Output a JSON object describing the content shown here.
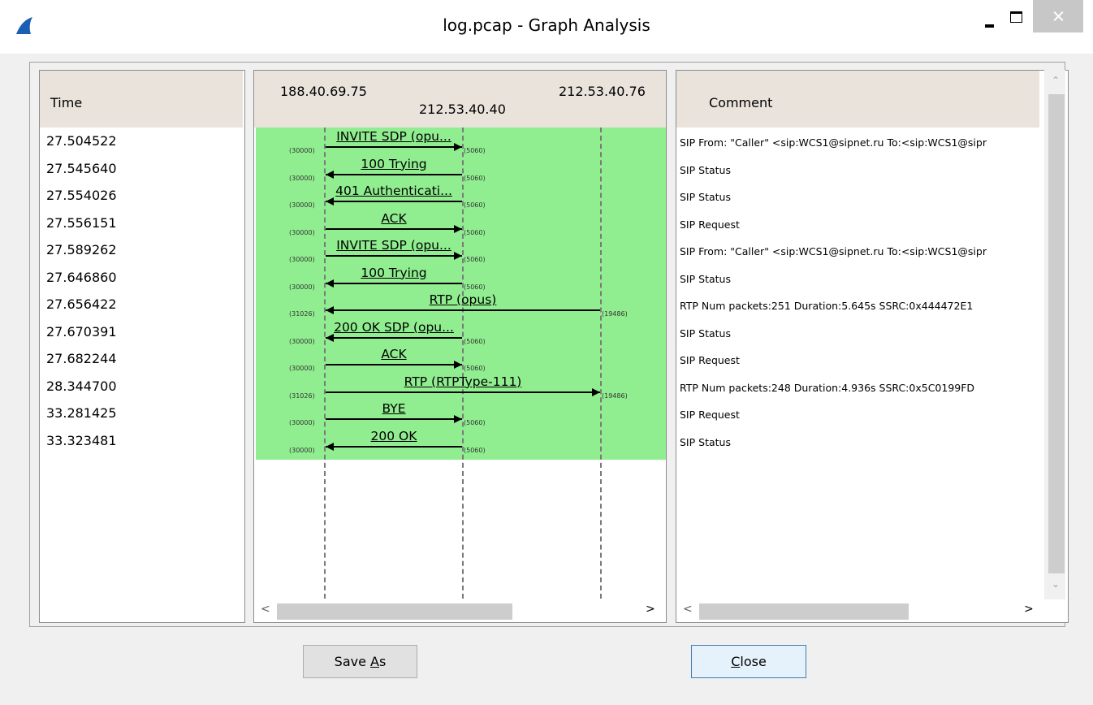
{
  "window": {
    "title": "log.pcap - Graph Analysis"
  },
  "time_pane": {
    "header": "Time",
    "times": [
      "27.504522",
      "27.545640",
      "27.554026",
      "27.556151",
      "27.589262",
      "27.646860",
      "27.656422",
      "27.670391",
      "27.682244",
      "28.344700",
      "33.281425",
      "33.323481"
    ]
  },
  "flow_pane": {
    "nodes": [
      "188.40.69.75",
      "212.53.40.40",
      "212.53.40.76"
    ],
    "messages": [
      {
        "label": "INVITE SDP (opu...",
        "from_port": "(30000)",
        "to_port": "(5060)",
        "direction": "right"
      },
      {
        "label": "100 Trying",
        "from_port": "(30000)",
        "to_port": "(5060)",
        "direction": "left"
      },
      {
        "label": "401 Authenticati...",
        "from_port": "(30000)",
        "to_port": "(5060)",
        "direction": "left"
      },
      {
        "label": "ACK",
        "from_port": "(30000)",
        "to_port": "(5060)",
        "direction": "right"
      },
      {
        "label": "INVITE SDP (opu...",
        "from_port": "(30000)",
        "to_port": "(5060)",
        "direction": "right"
      },
      {
        "label": "100 Trying",
        "from_port": "(30000)",
        "to_port": "(5060)",
        "direction": "left"
      },
      {
        "label": "RTP (opus)",
        "from_port": "(31026)",
        "to_port": "(19486)",
        "direction": "left",
        "span": "wide"
      },
      {
        "label": "200 OK SDP (opu...",
        "from_port": "(30000)",
        "to_port": "(5060)",
        "direction": "left"
      },
      {
        "label": "ACK",
        "from_port": "(30000)",
        "to_port": "(5060)",
        "direction": "right"
      },
      {
        "label": "RTP (RTPType-111)",
        "from_port": "(31026)",
        "to_port": "(19486)",
        "direction": "right",
        "span": "wide"
      },
      {
        "label": "BYE",
        "from_port": "(30000)",
        "to_port": "(5060)",
        "direction": "right"
      },
      {
        "label": "200 OK",
        "from_port": "(30000)",
        "to_port": "(5060)",
        "direction": "left"
      }
    ]
  },
  "comment_pane": {
    "header": "Comment",
    "comments": [
      "SIP From: \"Caller\" <sip:WCS1@sipnet.ru To:<sip:WCS1@sipr",
      "SIP Status",
      "SIP Status",
      "SIP Request",
      "SIP From: \"Caller\" <sip:WCS1@sipnet.ru To:<sip:WCS1@sipr",
      "SIP Status",
      "RTP Num packets:251  Duration:5.645s SSRC:0x444472E1",
      "SIP Status",
      "SIP Request",
      "RTP Num packets:248  Duration:4.936s SSRC:0x5C0199FD",
      "SIP Request",
      "SIP Status"
    ]
  },
  "buttons": {
    "save_as": {
      "pre": "Save ",
      "acc": "A",
      "post": "s"
    },
    "close": {
      "pre": "",
      "acc": "C",
      "post": "lose"
    }
  },
  "colors": {
    "flow_bg": "#90ee90",
    "header_bg": "#e9e3dc"
  }
}
